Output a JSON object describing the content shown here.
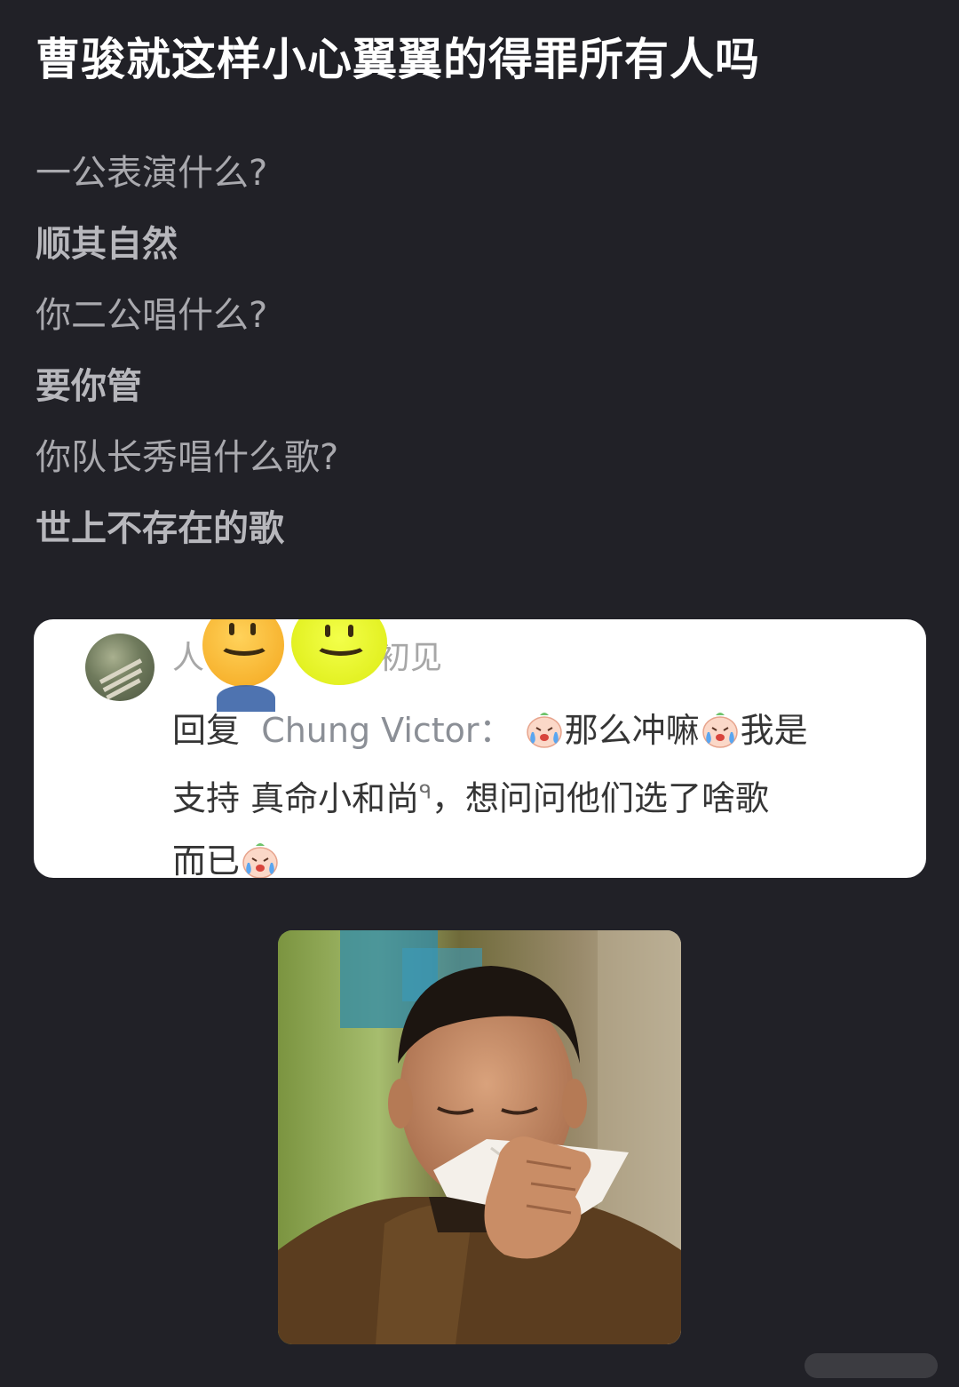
{
  "post": {
    "title": "曹骏就这样小心翼翼的得罪所有人吗"
  },
  "dialogue": [
    {
      "text": "一公表演什么?",
      "style": "question"
    },
    {
      "text": "顺其自然",
      "style": "answer"
    },
    {
      "text": "你二公唱什么?",
      "style": "question"
    },
    {
      "text": "要你管",
      "style": "answer"
    },
    {
      "text": "你队长秀唱什么歌?",
      "style": "question"
    },
    {
      "text": "世上不存在的歌",
      "style": "answer"
    }
  ],
  "comment_screenshot": {
    "username_start": "人",
    "username_end": "初见",
    "reply_prefix": "回复",
    "reply_to": "Chung Victor：",
    "segment_1": "那么冲嘛",
    "segment_2": "我是",
    "segment_3": "支持",
    "link_text": "真命小和尚",
    "link_icon": "ᑫ",
    "segment_4": "，想问问他们选了啥歌",
    "segment_5": "而已",
    "emoji": "crying-face-emoji",
    "avatar_icon": "landscape-avatar-icon",
    "stickers": [
      "smiley-sticker-orange",
      "smiley-sticker-yellow"
    ]
  },
  "photo": {
    "subject": "man-wiping-tears-with-tissue-image"
  },
  "colors": {
    "background": "#212127",
    "title": "#ffffff",
    "question_text": "#a9a9ae",
    "answer_text": "#b7b7bc",
    "card_background": "#ffffff",
    "comment_text": "#353535",
    "mention_text": "#8b8f96"
  }
}
